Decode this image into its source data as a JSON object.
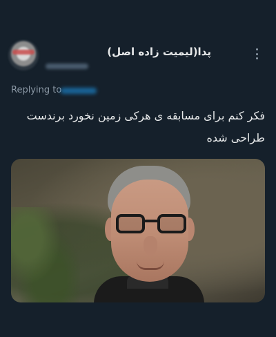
{
  "user": {
    "display_name": "پدا(لیمیت زاده اصل)",
    "avatar_icon": "avatar-image",
    "handle_blurred": true
  },
  "replying": {
    "label": "Replying to",
    "target_blurred": true
  },
  "tweet": {
    "text_line1": "فکر کنم برای مسابقه ی هرکی زمین نخورد برندست",
    "text_line2": "طراحی شده"
  },
  "media": {
    "description_icon": "photo-of-smiling-man-with-glasses"
  },
  "menu": {
    "icon": "more-options-icon"
  },
  "colors": {
    "background": "#15202b",
    "text_primary": "#e7e9ea",
    "text_secondary": "#8b98a5",
    "accent": "#1d9bf0"
  }
}
